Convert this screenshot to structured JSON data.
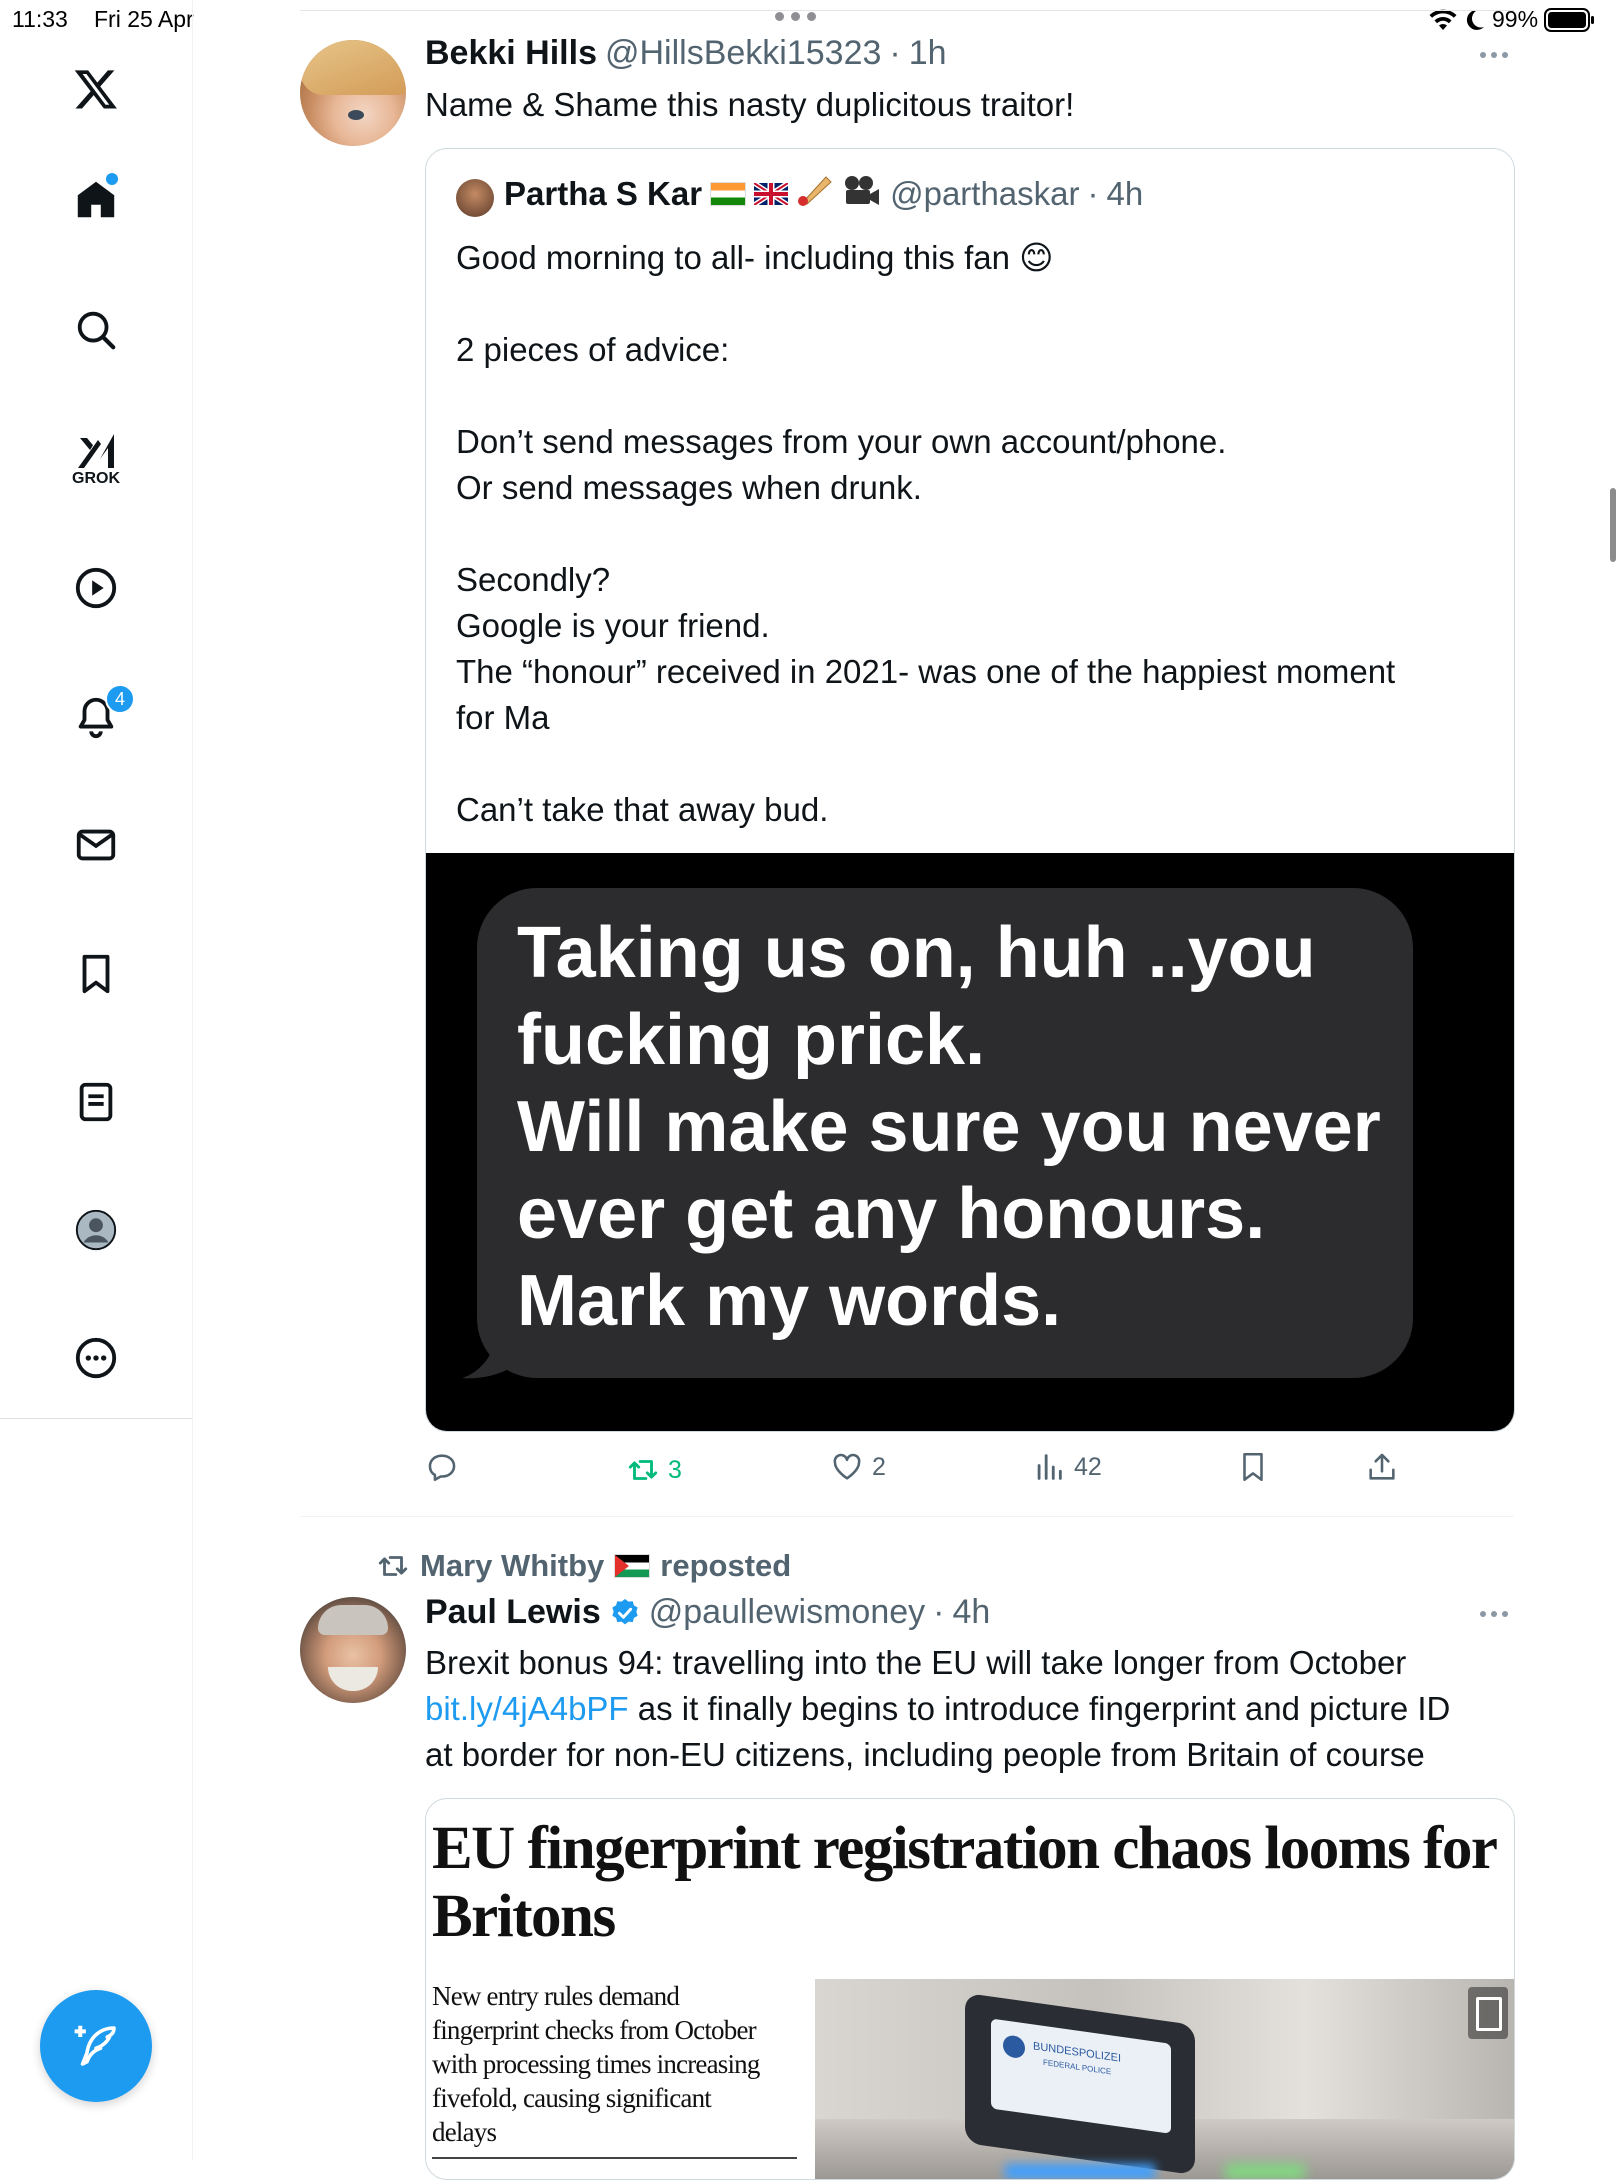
{
  "status_bar": {
    "time": "11:33",
    "date": "Fri 25 Apr",
    "battery": "99%"
  },
  "sidebar": {
    "grok_label": "GROK",
    "notifications_badge": "4",
    "colors": {
      "accent": "#1d9bf0"
    }
  },
  "tweet1": {
    "name": "Bekki Hills",
    "handle": "@HillsBekki15323",
    "dot": "·",
    "time": "1h",
    "text": "Name & Shame this nasty duplicitous traitor!",
    "quote": {
      "name": "Partha S Kar",
      "handle": "@parthaskar",
      "dot": "·",
      "time": "4h",
      "lines": [
        "Good morning to all- including this fan 😊",
        "",
        "2 pieces of advice:",
        "",
        "Don’t send messages from your own account/phone.",
        "Or send messages when drunk.",
        "",
        "Secondly?",
        "Google is your friend.",
        "The “honour” received in 2021- was one of the happiest moment",
        "for Ma",
        "",
        "Can’t take that away bud."
      ],
      "image_text": [
        "Taking us on, huh ..you",
        "fucking prick.",
        "Will make sure you never",
        "ever get any honours.",
        "Mark my words."
      ]
    },
    "actions": {
      "retweets": "3",
      "likes": "2",
      "views": "42"
    }
  },
  "tweet2": {
    "reposted_by": "Mary Whitby",
    "reposted_label": "reposted",
    "name": "Paul Lewis",
    "handle": "@paullewismoney",
    "dot": "·",
    "time": "4h",
    "text_line1": "Brexit bonus 94: travelling into the EU will take longer from October",
    "link": "bit.ly/4jA4bPF",
    "text_line2_rest": " as it finally begins to introduce fingerprint and picture ID",
    "text_line3": "at border for non-EU citizens, including people from Britain of course",
    "article": {
      "headline_line1": "EU fingerprint registration chaos looms for",
      "headline_line2": "Britons",
      "standfirst": [
        "New entry rules demand",
        "fingerprint checks from October",
        "with processing times increasing",
        "fivefold, causing significant",
        "delays"
      ],
      "machine_label1": "BUNDESPOLIZEI",
      "machine_label2": "FEDERAL POLICE"
    }
  }
}
